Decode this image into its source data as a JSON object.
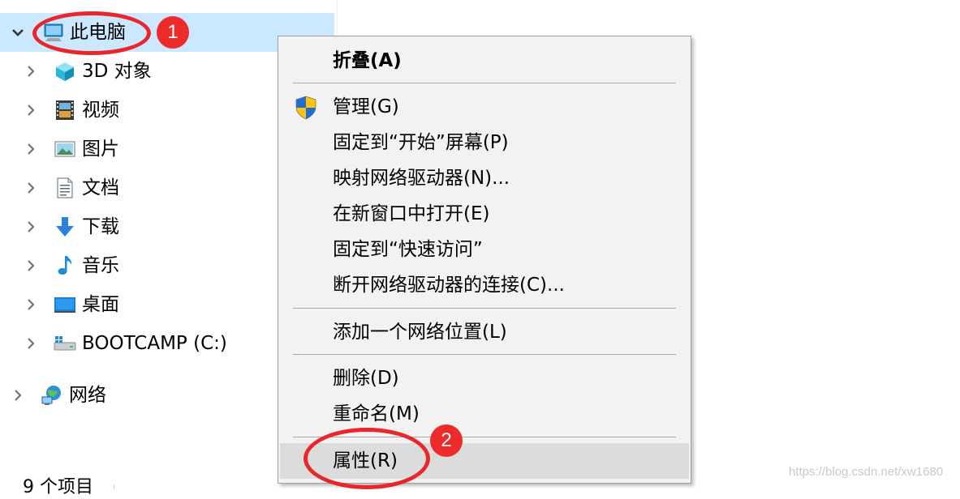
{
  "nav": {
    "items": [
      {
        "label": "此电脑",
        "icon": "computer-icon",
        "expanded": true,
        "selected": true
      },
      {
        "label": "3D 对象",
        "icon": "3d-objects-icon"
      },
      {
        "label": "视频",
        "icon": "videos-icon"
      },
      {
        "label": "图片",
        "icon": "pictures-icon"
      },
      {
        "label": "文档",
        "icon": "documents-icon"
      },
      {
        "label": "下载",
        "icon": "downloads-icon"
      },
      {
        "label": "音乐",
        "icon": "music-icon"
      },
      {
        "label": "桌面",
        "icon": "desktop-icon"
      },
      {
        "label": "BOOTCAMP (C:)",
        "icon": "drive-icon"
      },
      {
        "label": "网络",
        "icon": "network-icon"
      }
    ],
    "selected_color": "#cce8ff"
  },
  "status_bar": {
    "text": "9 个项目"
  },
  "annotations": {
    "badge1": "1",
    "badge2": "2",
    "color": "#e8262b"
  },
  "context_menu": {
    "items": [
      {
        "label": "折叠(A)",
        "bold": true
      },
      {
        "label": "管理(G)",
        "icon": "uac-shield-icon"
      },
      {
        "label": "固定到“开始”屏幕(P)"
      },
      {
        "label": "映射网络驱动器(N)..."
      },
      {
        "label": "在新窗口中打开(E)"
      },
      {
        "label": "固定到“快速访问”"
      },
      {
        "label": "断开网络驱动器的连接(C)..."
      },
      {
        "label": "添加一个网络位置(L)"
      },
      {
        "label": "删除(D)"
      },
      {
        "label": "重命名(M)"
      },
      {
        "label": "属性(R)",
        "highlighted": true
      }
    ]
  },
  "watermark": "https://blog.csdn.net/xw1680"
}
